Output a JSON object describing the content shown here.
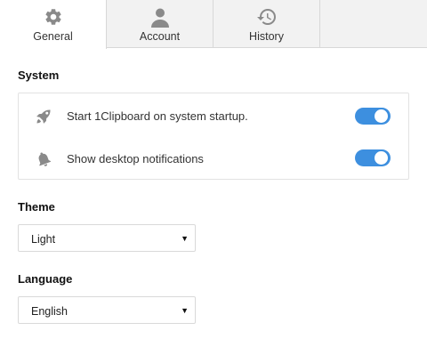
{
  "tabs": [
    {
      "label": "General",
      "icon": "gear-icon",
      "active": true
    },
    {
      "label": "Account",
      "icon": "user-icon",
      "active": false
    },
    {
      "label": "History",
      "icon": "history-icon",
      "active": false
    }
  ],
  "system": {
    "title": "System",
    "rows": [
      {
        "label": "Start 1Clipboard on system startup.",
        "icon": "rocket-icon",
        "enabled": true
      },
      {
        "label": "Show desktop notifications",
        "icon": "bell-icon",
        "enabled": true
      }
    ]
  },
  "theme": {
    "title": "Theme",
    "selected": "Light"
  },
  "language": {
    "title": "Language",
    "selected": "English"
  },
  "colors": {
    "accent": "#3d8fdf",
    "icon_gray": "#888888"
  }
}
